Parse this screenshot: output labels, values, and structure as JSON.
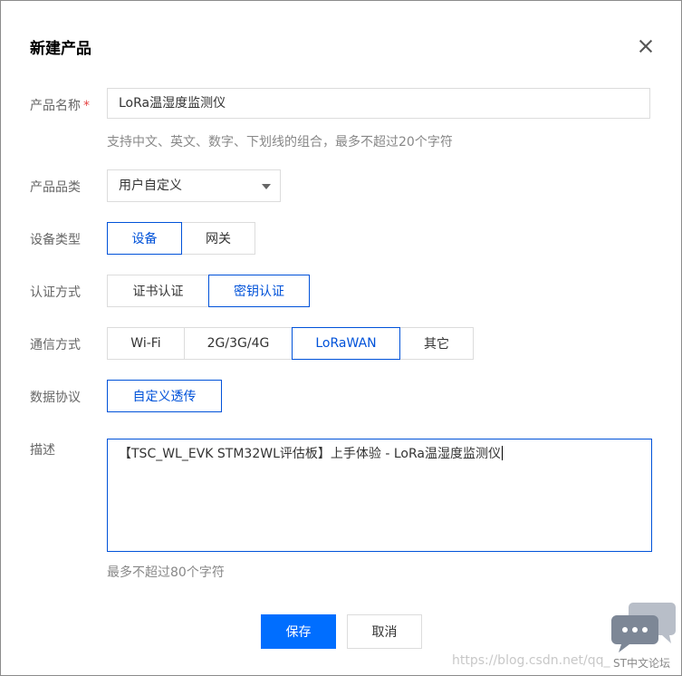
{
  "dialog": {
    "title": "新建产品",
    "close_icon": "close-icon"
  },
  "product_name": {
    "label": "产品名称",
    "required_mark": "*",
    "value": "LoRa温湿度监测仪",
    "hint": "支持中文、英文、数字、下划线的组合，最多不超过20个字符"
  },
  "category": {
    "label": "产品品类",
    "selected": "用户自定义"
  },
  "device_type": {
    "label": "设备类型",
    "options": [
      "设备",
      "网关"
    ],
    "selected_index": 0
  },
  "auth_method": {
    "label": "认证方式",
    "options": [
      "证书认证",
      "密钥认证"
    ],
    "selected_index": 1
  },
  "comm_method": {
    "label": "通信方式",
    "options": [
      "Wi-Fi",
      "2G/3G/4G",
      "LoRaWAN",
      "其它"
    ],
    "selected_index": 2
  },
  "data_protocol": {
    "label": "数据协议",
    "options": [
      "自定义透传"
    ],
    "selected_index": 0
  },
  "description": {
    "label": "描述",
    "value": "【TSC_WL_EVK STM32WL评估板】上手体验 - LoRa温湿度监测仪",
    "hint": "最多不超过80个字符"
  },
  "actions": {
    "save": "保存",
    "cancel": "取消"
  },
  "watermark": {
    "url_text": "https://blog.csdn.net/qq_",
    "forum_text": "ST中文论坛"
  },
  "colors": {
    "primary": "#006eff",
    "selected_border": "#0052d9",
    "required": "#e54545"
  }
}
